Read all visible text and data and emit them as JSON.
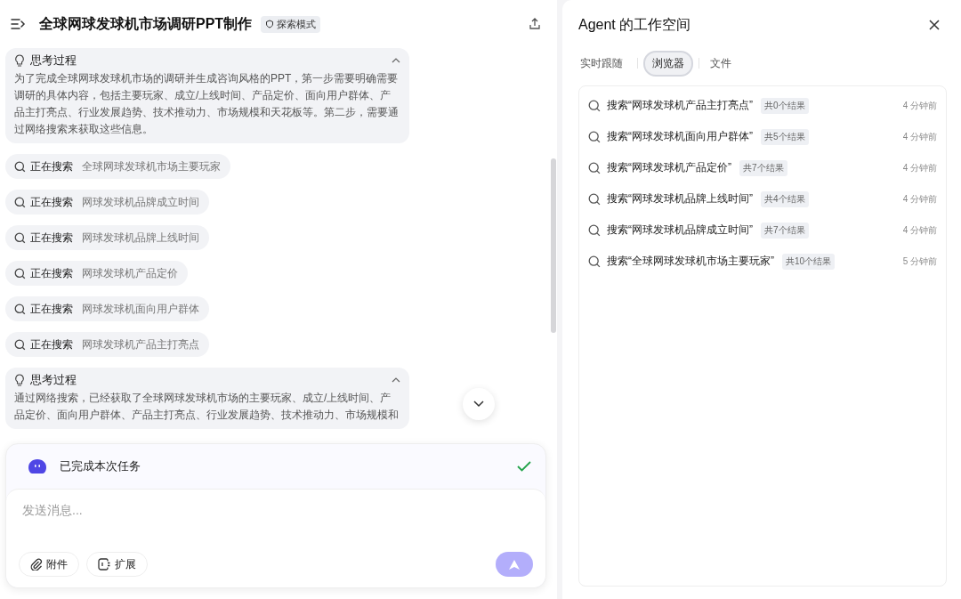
{
  "header": {
    "title": "全球网球发球机市场调研PPT制作",
    "mode_badge": "探索模式"
  },
  "chat": [
    {
      "kind": "thinking",
      "title": "思考过程",
      "expanded": true,
      "text": "为了完成全球网球发球机市场的调研并生成咨询风格的PPT，第一步需要明确需要调研的具体内容，包括主要玩家、成立/上线时间、产品定价、面向用户群体、产品主打亮点、行业发展趋势、技术推动力、市场规模和天花板等。第二步，需要通过网络搜索来获取这些信息。"
    },
    {
      "kind": "search",
      "label": "正在搜索",
      "query": "全球网球发球机市场主要玩家"
    },
    {
      "kind": "search",
      "label": "正在搜索",
      "query": "网球发球机品牌成立时间"
    },
    {
      "kind": "search",
      "label": "正在搜索",
      "query": "网球发球机品牌上线时间"
    },
    {
      "kind": "search",
      "label": "正在搜索",
      "query": "网球发球机产品定价"
    },
    {
      "kind": "search",
      "label": "正在搜索",
      "query": "网球发球机面向用户群体"
    },
    {
      "kind": "search",
      "label": "正在搜索",
      "query": "网球发球机产品主打亮点"
    },
    {
      "kind": "thinking",
      "title": "思考过程",
      "expanded": true,
      "text": "通过网络搜索，已经获取了全球网球发球机市场的主要玩家、成立/上线时间、产品定价、面向用户群体、产品主打亮点、行业发展趋势、技术推动力、市场规模和"
    }
  ],
  "task_status": {
    "text": "已完成本次任务",
    "done": true
  },
  "composer": {
    "placeholder": "发送消息...",
    "buttons": [
      {
        "kind": "attach",
        "label": "附件"
      },
      {
        "kind": "extend",
        "label": "扩展"
      }
    ],
    "send_disabled": true
  },
  "workspace": {
    "title": "Agent 的工作空间",
    "tabs": [
      {
        "label": "实时跟随",
        "selected": false
      },
      {
        "label": "浏览器",
        "selected": true
      },
      {
        "label": "文件",
        "selected": false
      }
    ],
    "results": [
      {
        "query": "搜索“网球发球机产品主打亮点”",
        "count": "共0个结果",
        "time": "4 分钟前"
      },
      {
        "query": "搜索“网球发球机面向用户群体”",
        "count": "共5个结果",
        "time": "4 分钟前"
      },
      {
        "query": "搜索“网球发球机产品定价”",
        "count": "共7个结果",
        "time": "4 分钟前"
      },
      {
        "query": "搜索“网球发球机品牌上线时间”",
        "count": "共4个结果",
        "time": "4 分钟前"
      },
      {
        "query": "搜索“网球发球机品牌成立时间”",
        "count": "共7个结果",
        "time": "4 分钟前"
      },
      {
        "query": "搜索“全球网球发球机市场主要玩家”",
        "count": "共10个结果",
        "time": "5 分钟前"
      }
    ]
  }
}
